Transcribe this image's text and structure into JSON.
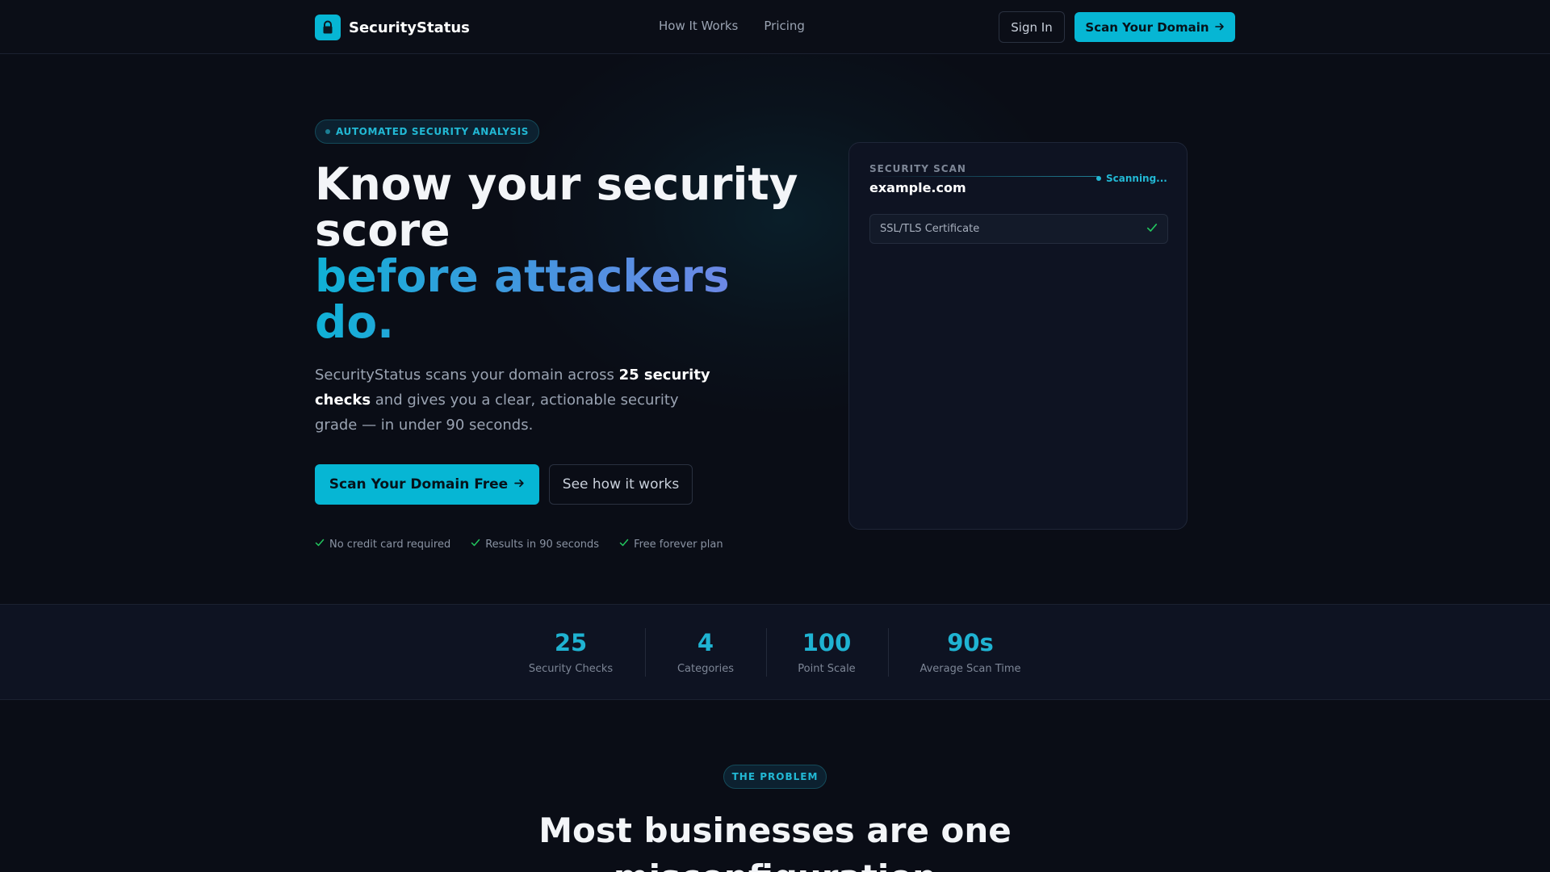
{
  "nav": {
    "brand": "SecurityStatus",
    "links": [
      "How It Works",
      "Pricing"
    ],
    "signin": "Sign In",
    "scan_cta": "Scan Your Domain"
  },
  "hero": {
    "badge": "AUTOMATED SECURITY ANALYSIS",
    "title_line1": "Know your security score",
    "title_accent": "before attackers do.",
    "desc_pre": "SecurityStatus scans your domain across ",
    "desc_bold": "25 security checks",
    "desc_post": " and gives you a clear, actionable security grade — in under 90 seconds.",
    "primary_cta": "Scan Your Domain Free",
    "secondary_cta": "See how it works",
    "perks": [
      "No credit card required",
      "Results in 90 seconds",
      "Free forever plan"
    ]
  },
  "scan_card": {
    "label": "SECURITY SCAN",
    "domain": "example.com",
    "status": "Scanning...",
    "checks": [
      {
        "name": "SSL/TLS Certificate",
        "passed": true
      }
    ]
  },
  "stats": [
    {
      "value": "25",
      "label": "Security Checks"
    },
    {
      "value": "4",
      "label": "Categories"
    },
    {
      "value": "100",
      "label": "Point Scale"
    },
    {
      "value": "90s",
      "label": "Average Scan Time"
    }
  ],
  "problem": {
    "badge": "THE PROBLEM",
    "title": "Most businesses are one misconfiguration"
  },
  "colors": {
    "accent": "#06b6d4",
    "background": "#0a0d16",
    "success": "#22c55e"
  }
}
